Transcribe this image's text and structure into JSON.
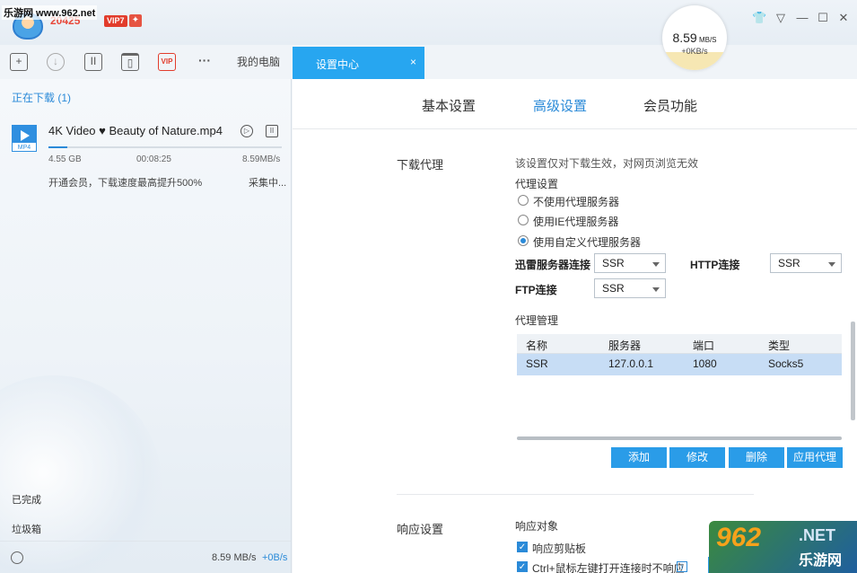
{
  "watermark": {
    "text": "乐游网 www.962.net"
  },
  "header": {
    "version": "20425",
    "vip_badge": "VIP7",
    "speed": {
      "value": "8.59",
      "unit": "MB/S",
      "upload": "+0KB/s"
    },
    "window_controls": [
      "skin",
      "menu",
      "minimize",
      "maximize",
      "close"
    ]
  },
  "toolbar": {
    "icons": [
      "add-icon",
      "download-icon",
      "pause-icon",
      "trash-icon",
      "vip-icon",
      "more-icon"
    ],
    "vip_label": "VIP",
    "more_label": "···",
    "my_pc_label": "我的电脑"
  },
  "sidebar": {
    "downloading_header": "正在下载 (1)",
    "item": {
      "file_ext": "MP4",
      "file_name": "4K Video ♥ Beauty of Nature.mp4",
      "size": "4.55 GB",
      "time_left": "00:08:25",
      "speed": "8.59MB/s",
      "progress": 0.08,
      "promo": "开通会员，下载速度最高提升500%",
      "status": "采集中..."
    },
    "completed_label": "已完成",
    "trash_label": "垃圾箱",
    "status_speed": "8.59 MB/s",
    "status_upload": "+0B/s"
  },
  "tabs": {
    "active_label": "设置中心",
    "close_label": "×"
  },
  "settings": {
    "tabs": [
      "基本设置",
      "高级设置",
      "会员功能"
    ],
    "active_tab_index": 1,
    "proxy": {
      "title": "下载代理",
      "note": "该设置仅对下载生效，对网页浏览无效",
      "settings_label": "代理设置",
      "options": [
        "不使用代理服务器",
        "使用IE代理服务器",
        "使用自定义代理服务器"
      ],
      "selected_option": 2,
      "thunder_label": "迅雷服务器连接",
      "thunder_value": "SSR",
      "http_label": "HTTP连接",
      "http_value": "SSR",
      "ftp_label": "FTP连接",
      "ftp_value": "SSR",
      "manager_label": "代理管理",
      "columns": [
        "名称",
        "服务器",
        "端口",
        "类型"
      ],
      "rows": [
        [
          "SSR",
          "127.0.0.1",
          "1080",
          "Socks5"
        ]
      ],
      "buttons": [
        "添加",
        "修改",
        "删除",
        "应用代理"
      ]
    },
    "response": {
      "title": "响应设置",
      "target_label": "响应对象",
      "items": [
        "响应剪贴板",
        "Ctrl+鼠标左键打开连接时不响应"
      ],
      "info_icon": "i"
    }
  },
  "corner_logo": {
    "num": "962",
    "net": ".NET",
    "cn": "乐游网"
  },
  "colors": {
    "accent": "#2a8ad8",
    "tab_active": "#27a6f0",
    "button": "#2a9ce8",
    "selected_row": "#c7ddf5"
  }
}
